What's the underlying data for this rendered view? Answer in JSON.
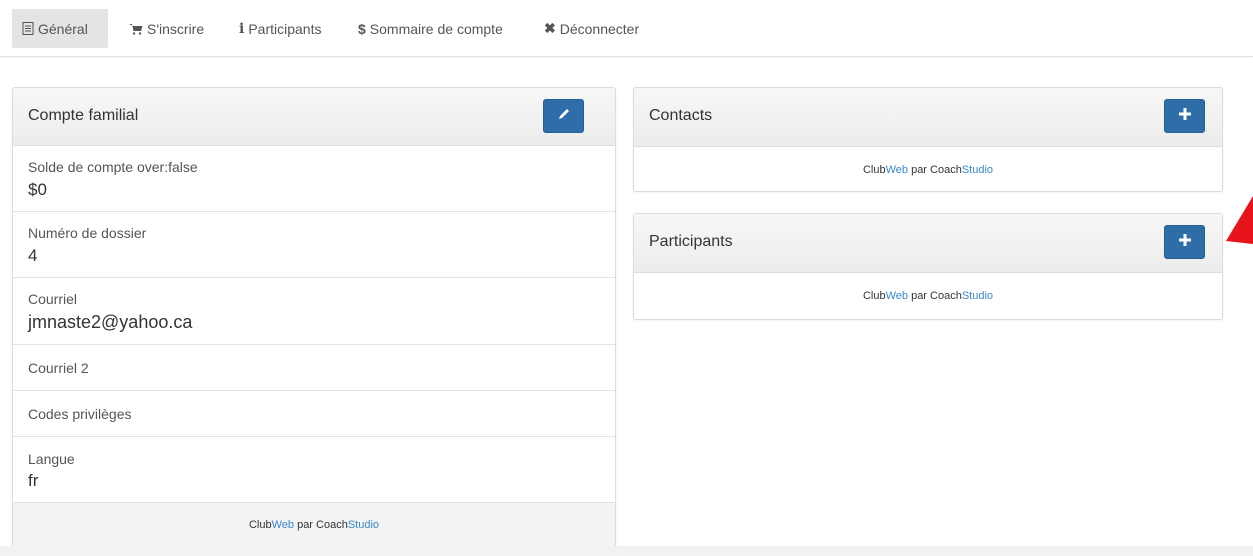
{
  "nav": {
    "items": [
      {
        "label": "Général",
        "icon": "document-icon",
        "active": true
      },
      {
        "label": "S'inscrire",
        "icon": "cart-icon"
      },
      {
        "label": "Participants",
        "icon": "info-icon"
      },
      {
        "label": "Sommaire de compte",
        "icon": "dollar-icon"
      },
      {
        "label": "Déconnecter",
        "icon": "close-icon"
      }
    ]
  },
  "account_panel": {
    "title": "Compte familial",
    "edit_icon": "pencil-icon",
    "fields": [
      {
        "label": "Solde de compte over:false",
        "value": "$0"
      },
      {
        "label": "Numéro de dossier",
        "value": "4"
      },
      {
        "label": "Courriel",
        "value": "jmnaste2@yahoo.ca"
      },
      {
        "label": "Courriel 2",
        "value": ""
      },
      {
        "label": "Codes privilèges",
        "value": ""
      },
      {
        "label": "Langue",
        "value": "fr"
      }
    ]
  },
  "contacts_panel": {
    "title": "Contacts",
    "add_icon": "plus-icon"
  },
  "participants_panel": {
    "title": "Participants",
    "add_icon": "plus-icon"
  },
  "footer": {
    "club": "Club",
    "web": "Web",
    "par": " par Coach",
    "studio": "Studio"
  },
  "colors": {
    "accent": "#2f6da8",
    "link": "#3a87c8",
    "annotation": "#e8141b"
  }
}
